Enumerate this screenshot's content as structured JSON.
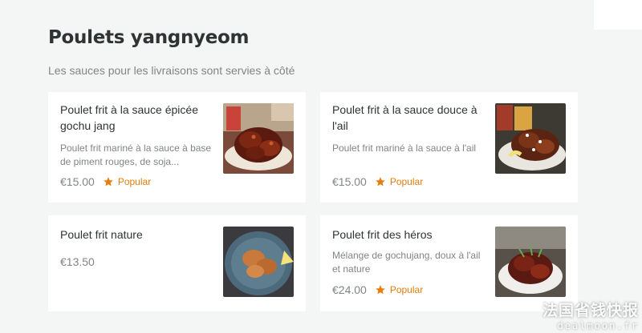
{
  "section": {
    "title": "Poulets yangnyeom",
    "subtitle": "Les sauces pour les livraisons sont servies à côté"
  },
  "colors": {
    "accent": "#e57e0c",
    "text": "#2e3333",
    "muted": "#828585",
    "background": "#f4f5f5"
  },
  "items": [
    {
      "name": "Poulet frit à la sauce épicée gochu jang",
      "description": "Poulet frit mariné à la sauce à base de piment rouges, de soja...",
      "price": "€15.00",
      "badge": "Popular",
      "icon": "star-icon"
    },
    {
      "name": "Poulet frit à la sauce douce à l'ail",
      "description": "Poulet frit mariné à la sauce à l'ail",
      "price": "€15.00",
      "badge": "Popular",
      "icon": "star-icon"
    },
    {
      "name": "Poulet frit nature",
      "description": "",
      "price": "€13.50",
      "badge": ""
    },
    {
      "name": "Poulet frit des héros",
      "description": "Mélange de gochujang, doux à l'ail et nature",
      "price": "€24.00",
      "badge": "Popular",
      "icon": "star-icon"
    }
  ],
  "watermark": {
    "cn": "法国省钱快报",
    "en": "dealmoon.fr"
  }
}
